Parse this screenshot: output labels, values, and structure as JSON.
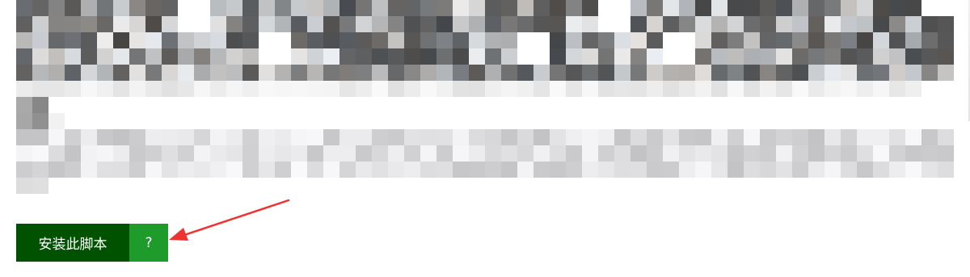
{
  "install": {
    "label": "安装此脚本",
    "help_label": "?"
  },
  "colors": {
    "install_bg": "#005200",
    "help_bg": "#1f9b2b",
    "arrow": "#ee3333"
  },
  "redacted_region": {
    "description_text": ""
  }
}
